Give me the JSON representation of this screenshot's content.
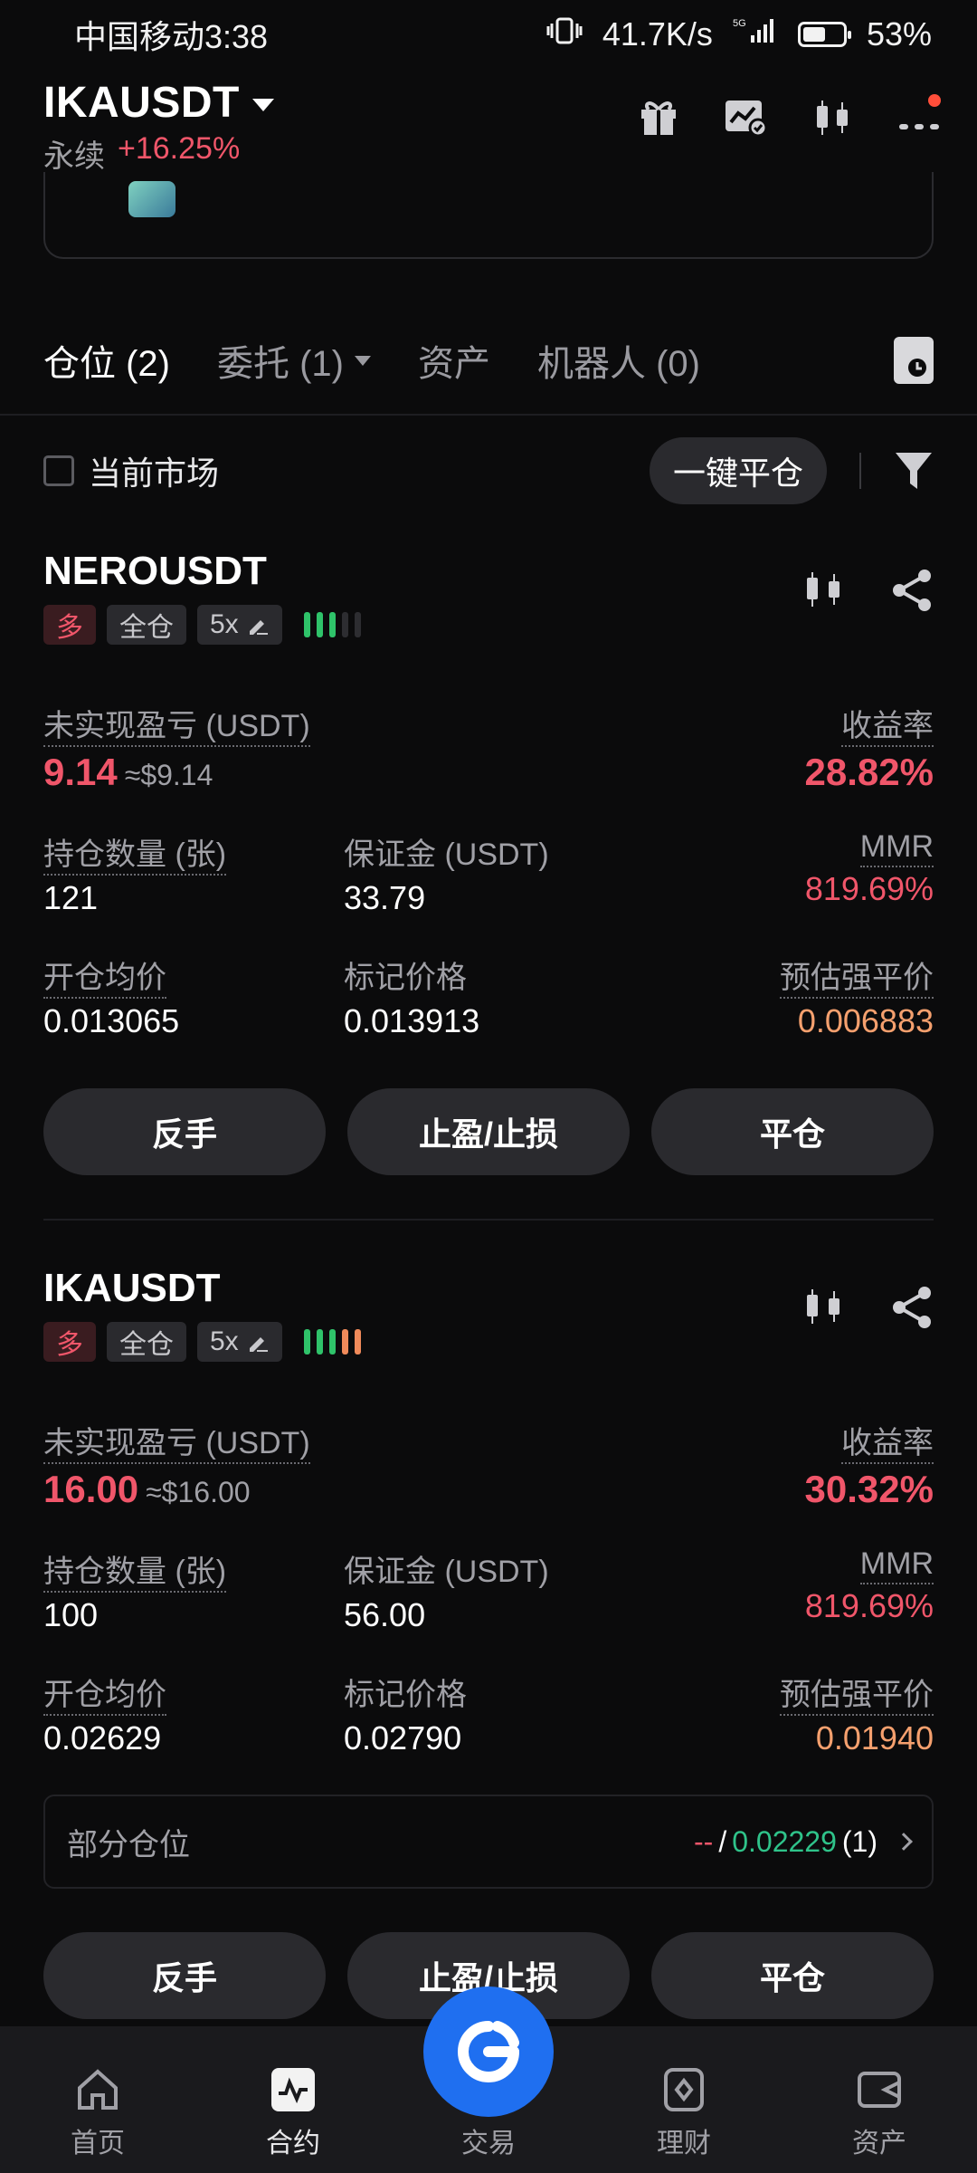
{
  "status_bar": {
    "carrier_time": "中国移动3:38",
    "network_speed": "41.7K/s",
    "battery_percent": "53%",
    "battery_level": 0.53
  },
  "header": {
    "symbol": "IKAUSDT",
    "type_label": "永续",
    "change": "+16.25%",
    "icons": [
      "gift-icon",
      "chart-check-icon",
      "candlestick-icon",
      "more-icon"
    ]
  },
  "tabs": [
    {
      "label": "仓位 (2)",
      "active": true
    },
    {
      "label": "委托 (1)",
      "dropdown": true
    },
    {
      "label": "资产"
    },
    {
      "label": "机器人 (0)"
    }
  ],
  "filter": {
    "current_market_label": "当前市场",
    "close_all_label": "一键平仓"
  },
  "positions": [
    {
      "symbol": "NEROUSDT",
      "side": "多",
      "margin_mode": "全仓",
      "leverage": "5x",
      "risk_bars": [
        "green",
        "green",
        "green",
        "gray",
        "gray"
      ],
      "unrealized_pnl_label": "未实现盈亏 (USDT)",
      "unrealized_pnl": "9.14",
      "unrealized_pnl_usd": "≈$9.14",
      "roe_label": "收益率",
      "roe": "28.82%",
      "qty_label": "持仓数量 (张)",
      "qty": "121",
      "margin_label": "保证金 (USDT)",
      "margin": "33.79",
      "mmr_label": "MMR",
      "mmr": "819.69%",
      "entry_label": "开仓均价",
      "entry": "0.013065",
      "mark_label": "标记价格",
      "mark": "0.013913",
      "liq_label": "预估强平价",
      "liq": "0.006883",
      "buttons": [
        "反手",
        "止盈/止损",
        "平仓"
      ]
    },
    {
      "symbol": "IKAUSDT",
      "side": "多",
      "margin_mode": "全仓",
      "leverage": "5x",
      "risk_bars": [
        "green",
        "green",
        "green",
        "orange",
        "orange"
      ],
      "unrealized_pnl_label": "未实现盈亏 (USDT)",
      "unrealized_pnl": "16.00",
      "unrealized_pnl_usd": "≈$16.00",
      "roe_label": "收益率",
      "roe": "30.32%",
      "qty_label": "持仓数量 (张)",
      "qty": "100",
      "margin_label": "保证金 (USDT)",
      "margin": "56.00",
      "mmr_label": "MMR",
      "mmr": "819.69%",
      "entry_label": "开仓均价",
      "entry": "0.02629",
      "mark_label": "标记价格",
      "mark": "0.02790",
      "liq_label": "预估强平价",
      "liq": "0.01940",
      "partial": {
        "label": "部分仓位",
        "tp": "--",
        "slash": "/",
        "sl": "0.02229",
        "count": "(1)"
      },
      "buttons": [
        "反手",
        "止盈/止损",
        "平仓"
      ]
    }
  ],
  "bottom_nav": [
    {
      "label": "首页",
      "icon": "home-icon"
    },
    {
      "label": "合约",
      "icon": "futures-icon",
      "active": true
    },
    {
      "label": "交易",
      "icon": "trade-icon"
    },
    {
      "label": "理财",
      "icon": "earn-icon"
    },
    {
      "label": "资产",
      "icon": "wallet-icon"
    }
  ]
}
